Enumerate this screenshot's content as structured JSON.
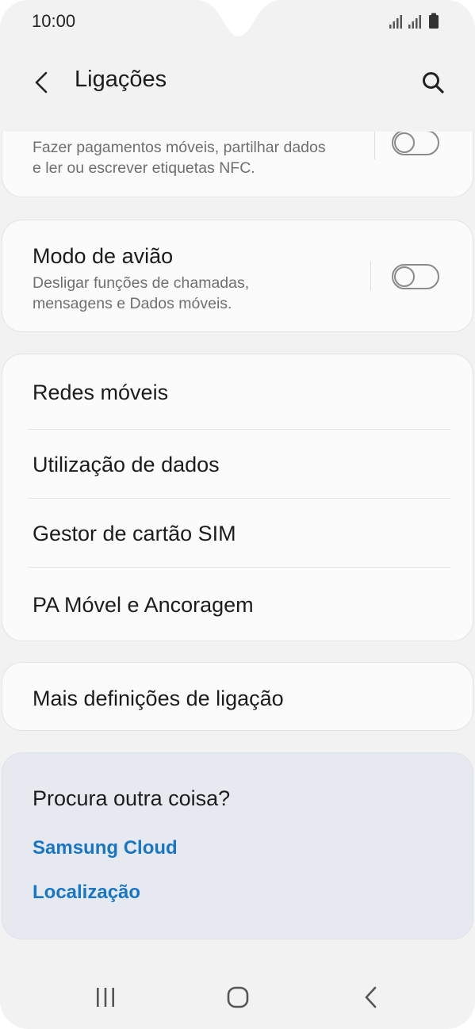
{
  "status_bar": {
    "time": "10:00",
    "icons": [
      "signal-icon",
      "signal-icon",
      "battery-icon"
    ]
  },
  "header": {
    "title": "Ligações",
    "back_icon": "chevron-left-icon",
    "search_icon": "search-icon"
  },
  "nfc": {
    "subtitle_line1": "Fazer pagamentos móveis, partilhar dados",
    "subtitle_line2": "e ler ou escrever etiquetas NFC.",
    "toggle_on": false
  },
  "airplane": {
    "title": "Modo de avião",
    "subtitle_line1": "Desligar funções de chamadas,",
    "subtitle_line2": "mensagens e Dados móveis.",
    "toggle_on": false
  },
  "network_menu": {
    "items": [
      {
        "label": "Redes móveis"
      },
      {
        "label": "Utilização de dados"
      },
      {
        "label": "Gestor de cartão SIM"
      },
      {
        "label": "PA Móvel e Ancoragem"
      }
    ]
  },
  "more_settings": {
    "label": "Mais definições de ligação"
  },
  "suggestions": {
    "heading": "Procura outra coisa?",
    "links": [
      {
        "label": "Samsung Cloud"
      },
      {
        "label": "Localização"
      }
    ]
  },
  "navigation_bar": {
    "recents_icon": "recents-icon",
    "home_icon": "home-icon",
    "back_icon": "back-icon"
  },
  "colors": {
    "background": "#f2f2f2",
    "card": "#fbfbfb",
    "info_card": "#e6eaf0",
    "link": "#1976c5"
  }
}
